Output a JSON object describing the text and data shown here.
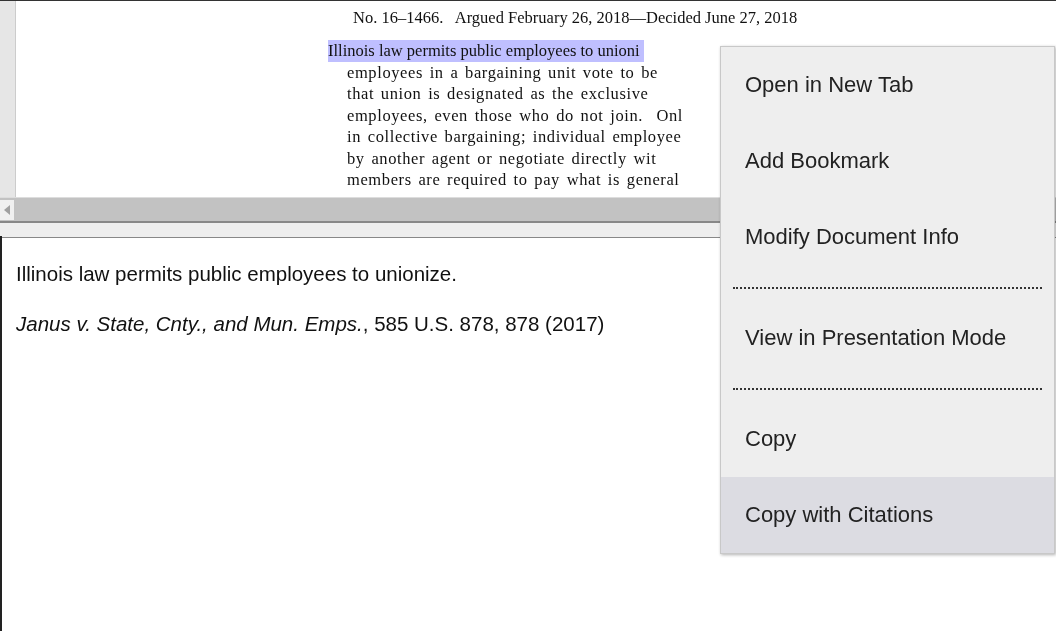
{
  "document": {
    "header": "No. 16–1466.   Argued February 26, 2018—Decided June 27, 2018",
    "lines": [
      {
        "text": "Illinois law permits public employees to unioni",
        "highlighted": true
      },
      {
        "text": "employees in a bargaining unit vote to be",
        "highlighted": false
      },
      {
        "text": "that union is designated as the exclusive",
        "highlighted": false
      },
      {
        "text": "employees, even those who do not join.  Onl",
        "highlighted": false
      },
      {
        "text": "in collective bargaining; individual employee",
        "highlighted": false
      },
      {
        "text": "by another agent or negotiate directly wit",
        "highlighted": false
      },
      {
        "text": "members are required to pay what is general",
        "highlighted": false
      }
    ]
  },
  "preview": {
    "quote": "Illinois law permits public employees to unionize.",
    "citation": "*Janus v. State, Cnty., and Mun. Emps.*, 585 U.S. 878, 878 (2017)"
  },
  "context_menu": [
    {
      "kind": "item",
      "label": "Open in New Tab",
      "selected": false
    },
    {
      "kind": "item",
      "label": "Add Bookmark",
      "selected": false
    },
    {
      "kind": "item",
      "label": "Modify Document Info",
      "selected": false
    },
    {
      "kind": "separator"
    },
    {
      "kind": "item",
      "label": "View in Presentation Mode",
      "selected": false
    },
    {
      "kind": "separator"
    },
    {
      "kind": "item",
      "label": "Copy",
      "selected": false
    },
    {
      "kind": "item",
      "label": "Copy with Citations",
      "selected": true
    }
  ]
}
